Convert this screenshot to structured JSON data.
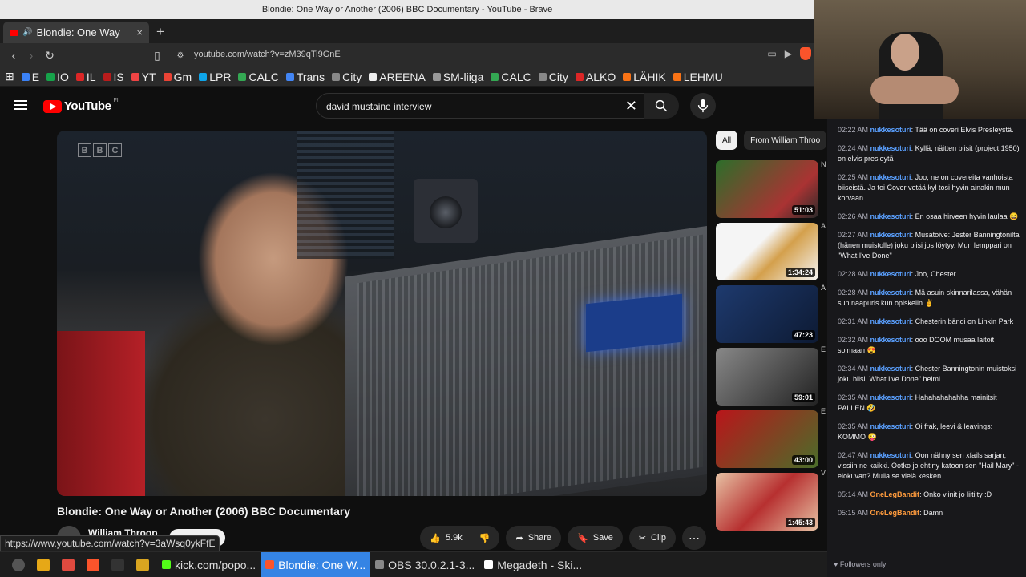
{
  "os": {
    "window_title": "Blondie: One Way or Another (2006) BBC Documentary - YouTube - Brave"
  },
  "browser": {
    "tab": {
      "title": "Blondie: One Way",
      "close": "×"
    },
    "new_tab": "+",
    "url": "youtube.com/watch?v=zM39qTi9GnE",
    "bookmarks": [
      {
        "label": "E",
        "color": "#3b82f6"
      },
      {
        "label": "IO",
        "color": "#16a34a"
      },
      {
        "label": "IL",
        "color": "#dc2626"
      },
      {
        "label": "IS",
        "color": "#b91c1c"
      },
      {
        "label": "YT",
        "color": "#ef4444"
      },
      {
        "label": "Gm",
        "color": "#ea4335"
      },
      {
        "label": "LPR",
        "color": "#0ea5e9"
      },
      {
        "label": "CALC",
        "color": "#34a853"
      },
      {
        "label": "Trans",
        "color": "#4285f4"
      },
      {
        "label": "City",
        "color": "#888888"
      },
      {
        "label": "AREENA",
        "color": "#eeeeee"
      },
      {
        "label": "SM-liiga",
        "color": "#999999"
      },
      {
        "label": "CALC",
        "color": "#34a853"
      },
      {
        "label": "City",
        "color": "#888888"
      },
      {
        "label": "ALKO",
        "color": "#dc2626"
      },
      {
        "label": "LÄHIK",
        "color": "#f97316"
      },
      {
        "label": "LEHMU",
        "color": "#f97316"
      }
    ]
  },
  "youtube": {
    "logo_text": "YouTube",
    "country_code": "FI",
    "search": {
      "value": "david mustaine interview"
    },
    "player": {
      "watermark": [
        "B",
        "B",
        "C"
      ]
    },
    "video_title": "Blondie: One Way or Another (2006) BBC Documentary",
    "channel_name": "William Throop",
    "actions": {
      "likes": "5.9k",
      "share": "Share",
      "save": "Save",
      "clip": "Clip",
      "more": "⋯"
    },
    "status_url": "https://www.youtube.com/watch?v=3aWsq0ykFfE",
    "chips": [
      {
        "label": "All",
        "active": true
      },
      {
        "label": "From William Throo",
        "active": false
      }
    ],
    "recommendations": [
      {
        "duration": "51:03",
        "bg": "linear-gradient(135deg,#2c6e2a,#a33 70%,#2a2a2a)"
      },
      {
        "duration": "1:34:24",
        "bg": "linear-gradient(135deg,#f5f5f5 40%,#d4a04c 60%,#f5f5f5)"
      },
      {
        "duration": "47:23",
        "bg": "linear-gradient(135deg,#1e3a6e,#0d1a33)"
      },
      {
        "duration": "59:01",
        "bg": "linear-gradient(135deg,#888,#222)"
      },
      {
        "duration": "43:00",
        "bg": "linear-gradient(135deg,#b9151a,#4a6e2a)"
      },
      {
        "duration": "1:45:43",
        "bg": "linear-gradient(135deg,#e7c2a4,#b73030 50%,#e7c2a4)"
      }
    ],
    "rec_side_letters": [
      "N",
      "A",
      "A",
      "E",
      "E",
      "V"
    ]
  },
  "chat": {
    "messages": [
      {
        "time": "02:22 AM",
        "user": "nukkesoturi",
        "user_color": "u1",
        "text": "Tää on coveri Elvis Presleystä."
      },
      {
        "time": "02:24 AM",
        "user": "nukkesoturi",
        "user_color": "u1",
        "text": "Kyllä, näitten biisit (project 1950) on elvis presleytä"
      },
      {
        "time": "02:25 AM",
        "user": "nukkesoturi",
        "user_color": "u1",
        "text": "Joo, ne on covereita vanhoista biiseistä. Ja toi Cover vetää kyl tosi hyvin ainakin mun korvaan."
      },
      {
        "time": "02:26 AM",
        "user": "nukkesoturi",
        "user_color": "u1",
        "text": "En osaa hirveen hyvin laulaa 😆"
      },
      {
        "time": "02:27 AM",
        "user": "nukkesoturi",
        "user_color": "u1",
        "text": "Musatoive: Jester Banningtonilta (hänen muistolle) joku biisi jos löytyy. Mun lemppari on \"What I've Done\""
      },
      {
        "time": "02:28 AM",
        "user": "nukkesoturi",
        "user_color": "u1",
        "text": "Joo, Chester"
      },
      {
        "time": "02:28 AM",
        "user": "nukkesoturi",
        "user_color": "u1",
        "text": "Mä asuin skinnarilassa, vähän sun naapuris kun opiskelin ✌"
      },
      {
        "time": "02:31 AM",
        "user": "nukkesoturi",
        "user_color": "u1",
        "text": "Chesterin bändi on Linkin Park"
      },
      {
        "time": "02:32 AM",
        "user": "nukkesoturi",
        "user_color": "u1",
        "text": "ooo DOOM musaa laitoit soimaan 😍"
      },
      {
        "time": "02:34 AM",
        "user": "nukkesoturi",
        "user_color": "u1",
        "text": "Chester Banningtonin muistoksi joku biisi. What I've Done\" helmi."
      },
      {
        "time": "02:35 AM",
        "user": "nukkesoturi",
        "user_color": "u1",
        "text": "Hahahahahahha mainitsit PALLEN 🤣"
      },
      {
        "time": "02:35 AM",
        "user": "nukkesoturi",
        "user_color": "u1",
        "text": "Oi frak, leevi & leavings: KOMMO 😜"
      },
      {
        "time": "02:47 AM",
        "user": "nukkesoturi",
        "user_color": "u1",
        "text": "Oon nähny sen xfails sarjan, vissiin ne kaikki. Ootko jo ehtiny katoon sen \"Hail Mary\" -elokuvan? Mulla se vielä kesken."
      },
      {
        "time": "05:14 AM",
        "user": "OneLegBandit",
        "user_color": "u2",
        "text": "Onko viinit jo liitiity :D"
      },
      {
        "time": "05:15 AM",
        "user": "OneLegBandit",
        "user_color": "u2",
        "text": "Damn"
      }
    ],
    "followers_only": "Followers only"
  },
  "taskbar": {
    "tasks": [
      {
        "label": "kick.com/popo...",
        "active": false,
        "color": "#53fc18"
      },
      {
        "label": "Blondie: One W...",
        "active": true,
        "color": "#fb542b"
      },
      {
        "label": "OBS 30.0.2.1-3...",
        "active": false,
        "color": "#888888"
      },
      {
        "label": "Megadeth - Ski...",
        "active": false,
        "color": "#ffffff"
      }
    ]
  }
}
